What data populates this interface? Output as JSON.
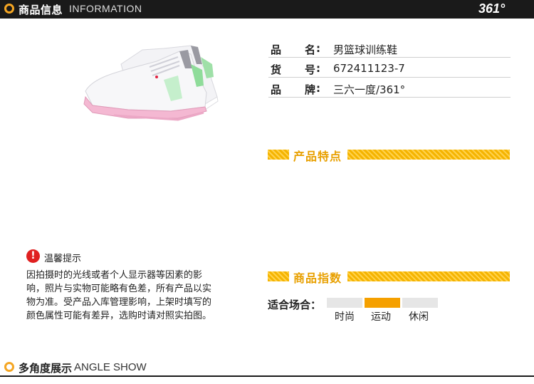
{
  "header": {
    "title": "商品信息",
    "subtitle": "INFORMATION",
    "logo": "361°"
  },
  "product": {
    "image_alt": "白粉配色篮球训练鞋",
    "rows": [
      {
        "k1": "品",
        "k2": "名",
        "value": "男篮球训练鞋"
      },
      {
        "k1": "货",
        "k2": "号",
        "value": "672411123-7"
      },
      {
        "k1": "品",
        "k2": "牌",
        "value": "三六一度/361°"
      }
    ]
  },
  "features_section": {
    "label": "产品特点"
  },
  "index_section": {
    "label": "商品指数"
  },
  "notice": {
    "icon": "exclamation-icon",
    "title": "温馨提示",
    "text": "因拍摄时的光线或者个人显示器等因素的影响，照片与实物可能略有色差，所有产品以实物为准。受产品入库管理影响，上架时填写的颜色属性可能有差异，选购时请对照实拍图。"
  },
  "occasion": {
    "label": "适合场合：",
    "options": [
      {
        "label": "时尚",
        "active": false
      },
      {
        "label": "运动",
        "active": true
      },
      {
        "label": "休闲",
        "active": false
      }
    ]
  },
  "bottom_header": {
    "title": "多角度展示",
    "subtitle": "ANGLE SHOW"
  },
  "colors": {
    "accent": "#f5a623",
    "stripe": "#f5b400",
    "active_box": "#f5a000",
    "inactive_box": "#e6e6e6",
    "header_bg": "#1a1a1a",
    "warn": "#e02020"
  }
}
